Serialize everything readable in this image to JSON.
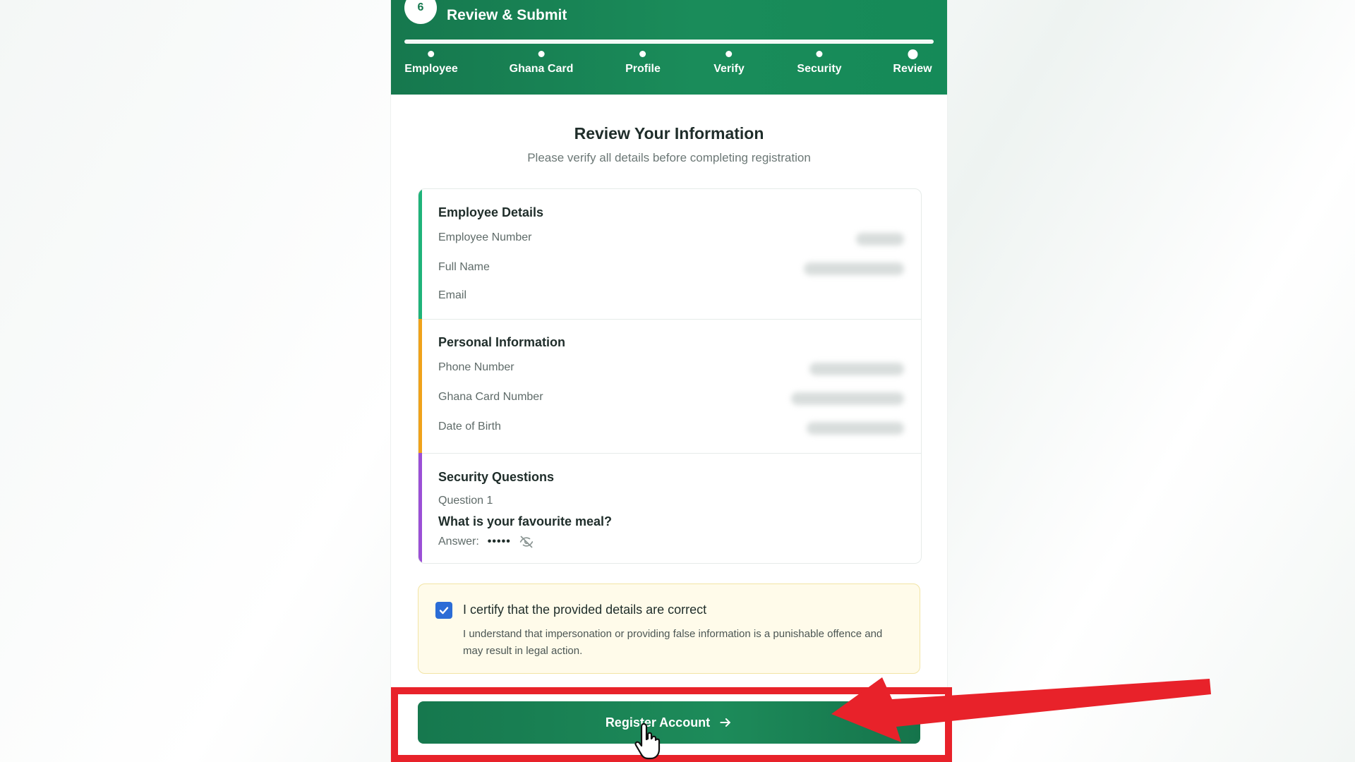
{
  "header": {
    "step_number": "6",
    "step_title": "Review & Submit",
    "steps": [
      {
        "label": "Employee"
      },
      {
        "label": "Ghana Card"
      },
      {
        "label": "Profile"
      },
      {
        "label": "Verify"
      },
      {
        "label": "Security"
      },
      {
        "label": "Review"
      }
    ]
  },
  "review": {
    "title": "Review Your Information",
    "subtitle": "Please verify all details before completing registration"
  },
  "employee_details": {
    "title": "Employee Details",
    "accent_color": "#1fb37a",
    "fields": [
      {
        "label": "Employee Number"
      },
      {
        "label": "Full Name"
      },
      {
        "label": "Email"
      }
    ]
  },
  "personal_information": {
    "title": "Personal Information",
    "accent_color": "#f0a21a",
    "fields": [
      {
        "label": "Phone Number"
      },
      {
        "label": "Ghana Card Number"
      },
      {
        "label": "Date of Birth"
      }
    ]
  },
  "security_questions": {
    "title": "Security Questions",
    "accent_color": "#9b4fd6",
    "question_number": "Question 1",
    "question_text": "What is your favourite meal?",
    "answer_label": "Answer:",
    "answer_mask": "•••••",
    "toggle_icon": "eye-off-icon"
  },
  "certify": {
    "checked": true,
    "title": "I certify that the provided details are correct",
    "body": "I understand that impersonation or providing false information is a punishable offence and may result in legal action."
  },
  "register_button": {
    "label": "Register Account",
    "icon": "arrow-right-icon"
  },
  "annotation": {
    "color": "#e8222a"
  }
}
